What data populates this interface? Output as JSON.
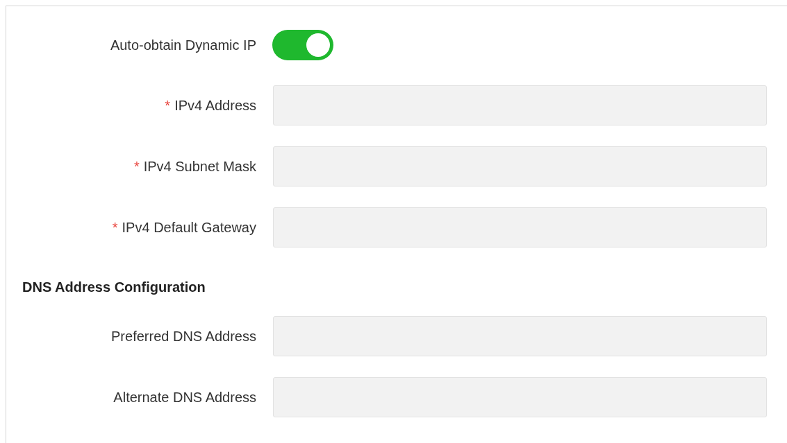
{
  "toggle": {
    "label": "Auto-obtain Dynamic IP",
    "on": true
  },
  "ip_fields": [
    {
      "required_mark": "*",
      "label": "IPv4 Address",
      "disabled": true
    },
    {
      "required_mark": "*",
      "label": "IPv4 Subnet Mask",
      "disabled": true
    },
    {
      "required_mark": "*",
      "label": "IPv4 Default Gateway",
      "disabled": true
    }
  ],
  "dns_section": {
    "title": "DNS Address Configuration",
    "fields": [
      {
        "label": "Preferred DNS Address",
        "disabled": true
      },
      {
        "label": "Alternate DNS Address",
        "disabled": true
      }
    ]
  }
}
